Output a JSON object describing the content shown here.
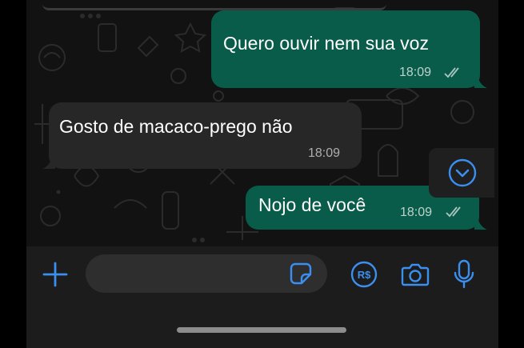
{
  "chat": {
    "messages": [
      {
        "direction": "outgoing",
        "text": "Quero ouvir nem sua voz",
        "time": "18:09",
        "status": "read"
      },
      {
        "direction": "incoming",
        "text": "Gosto de macaco-prego não",
        "time": "18:09"
      },
      {
        "direction": "outgoing",
        "text": "Nojo de você",
        "time": "18:09",
        "status": "read"
      }
    ]
  },
  "icons": {
    "scroll_down": "chevron-down-circle-icon",
    "attach": "plus-icon",
    "sticker": "sticker-icon",
    "payment": "rs-icon",
    "camera": "camera-icon",
    "microphone": "microphone-icon",
    "read_receipt": "double-check-icon"
  },
  "input": {
    "placeholder": ""
  },
  "colors": {
    "accent": "#3b8ff0",
    "outgoing_bubble": "#0a5c4a",
    "incoming_bubble": "#272727",
    "background": "#121212",
    "bar": "#1c1c1c"
  }
}
